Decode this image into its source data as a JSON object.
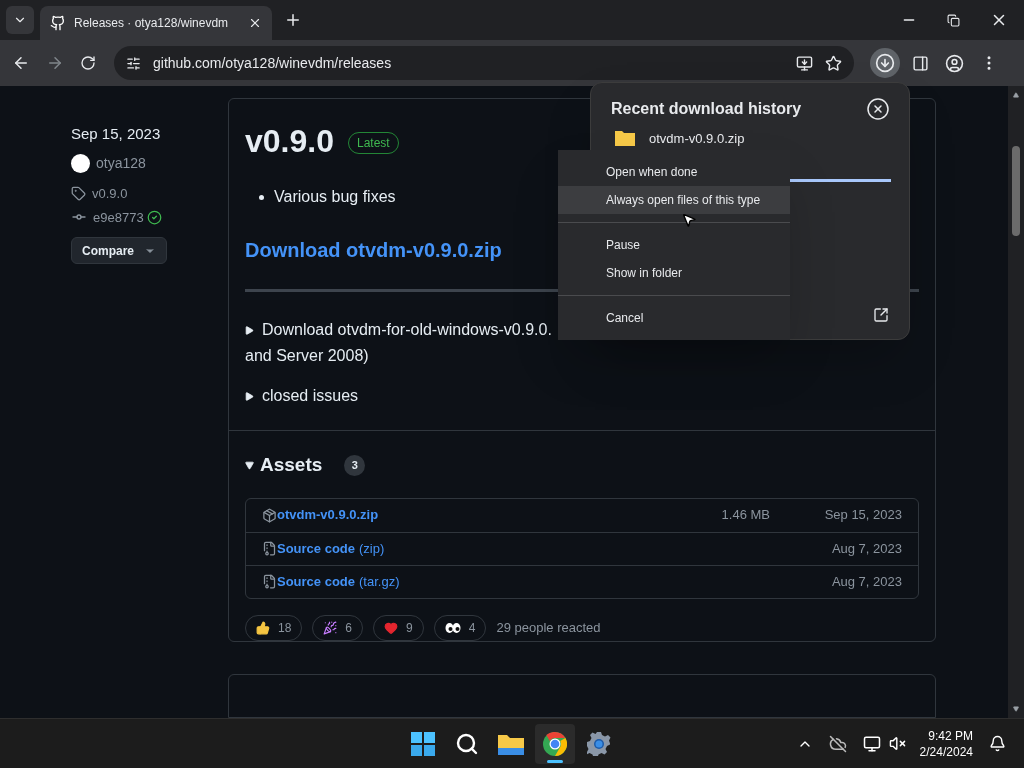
{
  "browser": {
    "tab": {
      "title": "Releases · otya128/winevdm",
      "selected": true
    },
    "address": "github.com/otya128/winevdm/releases"
  },
  "release": {
    "date": "Sep 15, 2023",
    "author": "otya128",
    "tag": "v0.9.0",
    "commit": "e9e8773",
    "compare": "Compare",
    "title": "v0.9.0",
    "badge": "Latest",
    "notes": [
      "Various bug fixes"
    ],
    "download_link": "Download otvdm-v0.9.0.zip",
    "details": [
      {
        "text": "Download otvdm-for-old-windows-v0.9.0.",
        "continuation": "and Server 2008)"
      },
      {
        "text": "closed issues"
      }
    ]
  },
  "assets": {
    "title": "Assets",
    "count": "3",
    "rows": [
      {
        "kind": "package",
        "name": "otvdm-v0.9.0.zip",
        "size": "1.46 MB",
        "date": "Sep 15, 2023"
      },
      {
        "kind": "source",
        "name": "Source code",
        "suffix": "(zip)",
        "date": "Aug 7, 2023"
      },
      {
        "kind": "source",
        "name": "Source code",
        "suffix": "(tar.gz)",
        "date": "Aug 7, 2023"
      }
    ]
  },
  "reactions": {
    "items": [
      {
        "kind": "thumbs_up",
        "count": "18"
      },
      {
        "kind": "hooray",
        "count": "6"
      },
      {
        "kind": "heart",
        "count": "9"
      },
      {
        "kind": "eyes",
        "count": "4"
      }
    ],
    "summary": "29 people reacted"
  },
  "downloads_panel": {
    "title": "Recent download history",
    "file": "otvdm-v0.9.0.zip",
    "level": 1
  },
  "context_menu": {
    "groups": [
      [
        {
          "label": "Open when done",
          "selected": false
        },
        {
          "label": "Always open files of this type",
          "selected": true
        }
      ],
      [
        {
          "label": "Pause",
          "selected": false
        },
        {
          "label": "Show in folder",
          "selected": false
        }
      ],
      [
        {
          "label": "Cancel",
          "selected": false
        }
      ]
    ]
  },
  "taskbar": {
    "apps": [
      {
        "kind": "start",
        "selected": false
      },
      {
        "kind": "search",
        "selected": false
      },
      {
        "kind": "files",
        "selected": false
      },
      {
        "kind": "chrome",
        "selected": true
      },
      {
        "kind": "settings",
        "selected": false
      }
    ],
    "time": "9:42 PM",
    "date": "2/24/2024"
  }
}
